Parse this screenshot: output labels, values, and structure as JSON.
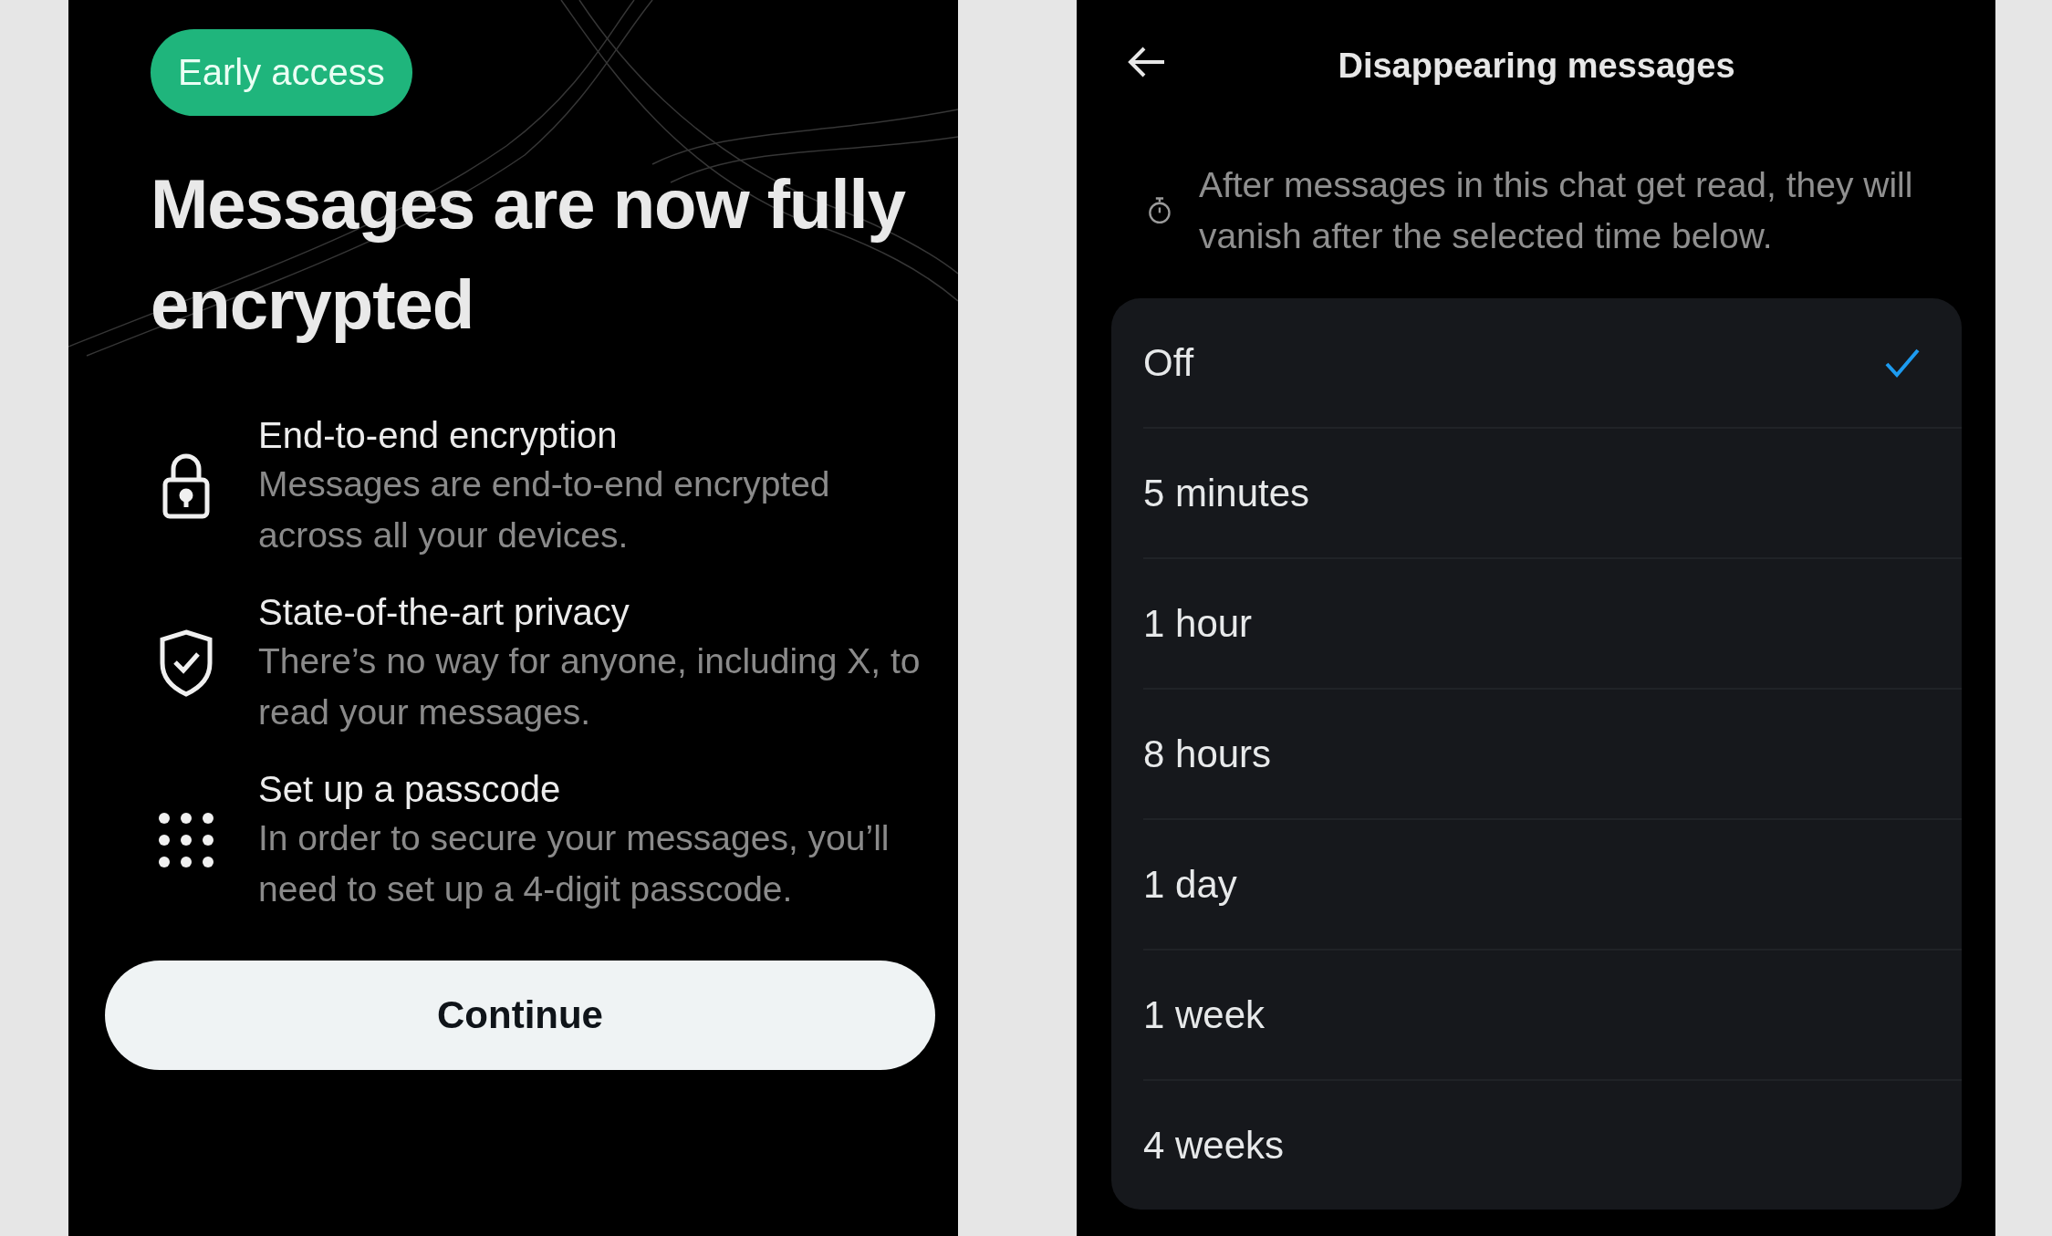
{
  "onboarding": {
    "badge": "Early access",
    "headline": "Messages are now fully encrypted",
    "features": [
      {
        "kind": "lock",
        "title": "End-to-end encryption",
        "body": "Messages are end-to-end encrypted across all your devices."
      },
      {
        "kind": "shield",
        "title": "State-of-the-art privacy",
        "body": "There’s no way for anyone, including X, to read your messages."
      },
      {
        "kind": "keypad",
        "title": "Set up a passcode",
        "body": "In order to secure your messages, you’ll need to set up a 4-digit passcode."
      }
    ],
    "button": "Continue"
  },
  "disappearing": {
    "title": "Disappearing messages",
    "description": "After messages in this chat get read, they will vanish after the selected time below.",
    "options": [
      {
        "label": "Off",
        "selected": true
      },
      {
        "label": "5 minutes",
        "selected": false
      },
      {
        "label": "1 hour",
        "selected": false
      },
      {
        "label": "8 hours",
        "selected": false
      },
      {
        "label": "1 day",
        "selected": false
      },
      {
        "label": "1 week",
        "selected": false
      },
      {
        "label": "4 weeks",
        "selected": false
      }
    ]
  }
}
